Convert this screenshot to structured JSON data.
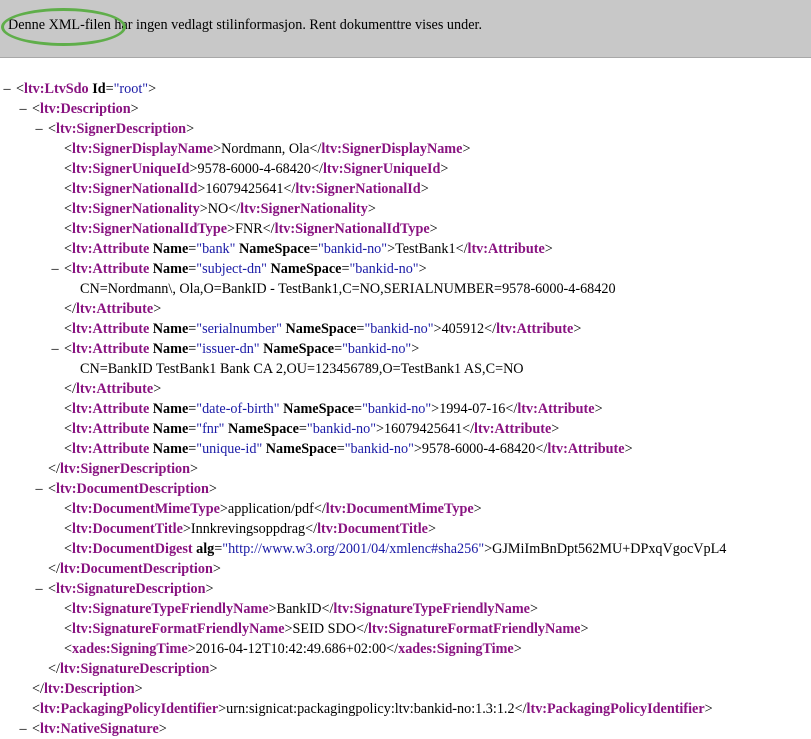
{
  "banner": {
    "message": "Denne XML-filen har ingen vedlagt stilinformasjon. Rent dokumenttre vises under."
  },
  "toggle_symbol": "–",
  "accent_colors": {
    "tag": "#881280",
    "attr_value": "#1a1aa6",
    "banner_bg": "#c8c8c8",
    "highlight_ring": "#5fae4a"
  },
  "lines": [
    {
      "toggle": true,
      "parts": [
        {
          "c": "tg",
          "v": "<"
        },
        {
          "c": "t",
          "v": "ltv:LtvSdo"
        },
        {
          "c": "tx",
          "v": " "
        },
        {
          "c": "an",
          "v": "Id"
        },
        {
          "c": "tg",
          "v": "="
        },
        {
          "c": "av",
          "v": "\"root\""
        },
        {
          "c": "tg",
          "v": ">"
        }
      ]
    },
    {
      "toggle": true,
      "parts": [
        {
          "c": "tg",
          "v": "<"
        },
        {
          "c": "t",
          "v": "ltv:Description"
        },
        {
          "c": "tg",
          "v": ">"
        }
      ]
    },
    {
      "toggle": true,
      "parts": [
        {
          "c": "tg",
          "v": "<"
        },
        {
          "c": "t",
          "v": "ltv:SignerDescription"
        },
        {
          "c": "tg",
          "v": ">"
        }
      ]
    },
    {
      "toggle": false,
      "parts": [
        {
          "c": "tg",
          "v": "<"
        },
        {
          "c": "t",
          "v": "ltv:SignerDisplayName"
        },
        {
          "c": "tg",
          "v": ">"
        },
        {
          "c": "tx",
          "v": "Nordmann, Ola"
        },
        {
          "c": "tg",
          "v": "</"
        },
        {
          "c": "t",
          "v": "ltv:SignerDisplayName"
        },
        {
          "c": "tg",
          "v": ">"
        }
      ]
    },
    {
      "toggle": false,
      "parts": [
        {
          "c": "tg",
          "v": "<"
        },
        {
          "c": "t",
          "v": "ltv:SignerUniqueId"
        },
        {
          "c": "tg",
          "v": ">"
        },
        {
          "c": "tx",
          "v": "9578-6000-4-68420"
        },
        {
          "c": "tg",
          "v": "</"
        },
        {
          "c": "t",
          "v": "ltv:SignerUniqueId"
        },
        {
          "c": "tg",
          "v": ">"
        }
      ]
    },
    {
      "toggle": false,
      "parts": [
        {
          "c": "tg",
          "v": "<"
        },
        {
          "c": "t",
          "v": "ltv:SignerNationalId"
        },
        {
          "c": "tg",
          "v": ">"
        },
        {
          "c": "tx",
          "v": "16079425641"
        },
        {
          "c": "tg",
          "v": "</"
        },
        {
          "c": "t",
          "v": "ltv:SignerNationalId"
        },
        {
          "c": "tg",
          "v": ">"
        }
      ]
    },
    {
      "toggle": false,
      "parts": [
        {
          "c": "tg",
          "v": "<"
        },
        {
          "c": "t",
          "v": "ltv:SignerNationality"
        },
        {
          "c": "tg",
          "v": ">"
        },
        {
          "c": "tx",
          "v": "NO"
        },
        {
          "c": "tg",
          "v": "</"
        },
        {
          "c": "t",
          "v": "ltv:SignerNationality"
        },
        {
          "c": "tg",
          "v": ">"
        }
      ]
    },
    {
      "toggle": false,
      "parts": [
        {
          "c": "tg",
          "v": "<"
        },
        {
          "c": "t",
          "v": "ltv:SignerNationalIdType"
        },
        {
          "c": "tg",
          "v": ">"
        },
        {
          "c": "tx",
          "v": "FNR"
        },
        {
          "c": "tg",
          "v": "</"
        },
        {
          "c": "t",
          "v": "ltv:SignerNationalIdType"
        },
        {
          "c": "tg",
          "v": ">"
        }
      ]
    },
    {
      "toggle": false,
      "parts": [
        {
          "c": "tg",
          "v": "<"
        },
        {
          "c": "t",
          "v": "ltv:Attribute"
        },
        {
          "c": "tx",
          "v": " "
        },
        {
          "c": "an",
          "v": "Name"
        },
        {
          "c": "tg",
          "v": "="
        },
        {
          "c": "av",
          "v": "\"bank\""
        },
        {
          "c": "tx",
          "v": " "
        },
        {
          "c": "an",
          "v": "NameSpace"
        },
        {
          "c": "tg",
          "v": "="
        },
        {
          "c": "av",
          "v": "\"bankid-no\""
        },
        {
          "c": "tg",
          "v": ">"
        },
        {
          "c": "tx",
          "v": "TestBank1"
        },
        {
          "c": "tg",
          "v": "</"
        },
        {
          "c": "t",
          "v": "ltv:Attribute"
        },
        {
          "c": "tg",
          "v": ">"
        }
      ]
    },
    {
      "toggle": true,
      "parts": [
        {
          "c": "tg",
          "v": "<"
        },
        {
          "c": "t",
          "v": "ltv:Attribute"
        },
        {
          "c": "tx",
          "v": " "
        },
        {
          "c": "an",
          "v": "Name"
        },
        {
          "c": "tg",
          "v": "="
        },
        {
          "c": "av",
          "v": "\"subject-dn\""
        },
        {
          "c": "tx",
          "v": " "
        },
        {
          "c": "an",
          "v": "NameSpace"
        },
        {
          "c": "tg",
          "v": "="
        },
        {
          "c": "av",
          "v": "\"bankid-no\""
        },
        {
          "c": "tg",
          "v": ">"
        }
      ]
    },
    {
      "toggle": false,
      "parts": [
        {
          "c": "tx",
          "v": "CN=Nordmann\\, Ola,O=BankID - TestBank1,C=NO,SERIALNUMBER=9578-6000-4-68420"
        }
      ]
    },
    {
      "toggle": false,
      "parts": [
        {
          "c": "tg",
          "v": "</"
        },
        {
          "c": "t",
          "v": "ltv:Attribute"
        },
        {
          "c": "tg",
          "v": ">"
        }
      ]
    },
    {
      "toggle": false,
      "parts": [
        {
          "c": "tg",
          "v": "<"
        },
        {
          "c": "t",
          "v": "ltv:Attribute"
        },
        {
          "c": "tx",
          "v": " "
        },
        {
          "c": "an",
          "v": "Name"
        },
        {
          "c": "tg",
          "v": "="
        },
        {
          "c": "av",
          "v": "\"serialnumber\""
        },
        {
          "c": "tx",
          "v": " "
        },
        {
          "c": "an",
          "v": "NameSpace"
        },
        {
          "c": "tg",
          "v": "="
        },
        {
          "c": "av",
          "v": "\"bankid-no\""
        },
        {
          "c": "tg",
          "v": ">"
        },
        {
          "c": "tx",
          "v": "405912"
        },
        {
          "c": "tg",
          "v": "</"
        },
        {
          "c": "t",
          "v": "ltv:Attribute"
        },
        {
          "c": "tg",
          "v": ">"
        }
      ]
    },
    {
      "toggle": true,
      "parts": [
        {
          "c": "tg",
          "v": "<"
        },
        {
          "c": "t",
          "v": "ltv:Attribute"
        },
        {
          "c": "tx",
          "v": " "
        },
        {
          "c": "an",
          "v": "Name"
        },
        {
          "c": "tg",
          "v": "="
        },
        {
          "c": "av",
          "v": "\"issuer-dn\""
        },
        {
          "c": "tx",
          "v": " "
        },
        {
          "c": "an",
          "v": "NameSpace"
        },
        {
          "c": "tg",
          "v": "="
        },
        {
          "c": "av",
          "v": "\"bankid-no\""
        },
        {
          "c": "tg",
          "v": ">"
        }
      ]
    },
    {
      "toggle": false,
      "parts": [
        {
          "c": "tx",
          "v": "CN=BankID TestBank1 Bank CA 2,OU=123456789,O=TestBank1 AS,C=NO"
        }
      ]
    },
    {
      "toggle": false,
      "parts": [
        {
          "c": "tg",
          "v": "</"
        },
        {
          "c": "t",
          "v": "ltv:Attribute"
        },
        {
          "c": "tg",
          "v": ">"
        }
      ]
    },
    {
      "toggle": false,
      "parts": [
        {
          "c": "tg",
          "v": "<"
        },
        {
          "c": "t",
          "v": "ltv:Attribute"
        },
        {
          "c": "tx",
          "v": " "
        },
        {
          "c": "an",
          "v": "Name"
        },
        {
          "c": "tg",
          "v": "="
        },
        {
          "c": "av",
          "v": "\"date-of-birth\""
        },
        {
          "c": "tx",
          "v": " "
        },
        {
          "c": "an",
          "v": "NameSpace"
        },
        {
          "c": "tg",
          "v": "="
        },
        {
          "c": "av",
          "v": "\"bankid-no\""
        },
        {
          "c": "tg",
          "v": ">"
        },
        {
          "c": "tx",
          "v": "1994-07-16"
        },
        {
          "c": "tg",
          "v": "</"
        },
        {
          "c": "t",
          "v": "ltv:Attribute"
        },
        {
          "c": "tg",
          "v": ">"
        }
      ]
    },
    {
      "toggle": false,
      "parts": [
        {
          "c": "tg",
          "v": "<"
        },
        {
          "c": "t",
          "v": "ltv:Attribute"
        },
        {
          "c": "tx",
          "v": " "
        },
        {
          "c": "an",
          "v": "Name"
        },
        {
          "c": "tg",
          "v": "="
        },
        {
          "c": "av",
          "v": "\"fnr\""
        },
        {
          "c": "tx",
          "v": " "
        },
        {
          "c": "an",
          "v": "NameSpace"
        },
        {
          "c": "tg",
          "v": "="
        },
        {
          "c": "av",
          "v": "\"bankid-no\""
        },
        {
          "c": "tg",
          "v": ">"
        },
        {
          "c": "tx",
          "v": "16079425641"
        },
        {
          "c": "tg",
          "v": "</"
        },
        {
          "c": "t",
          "v": "ltv:Attribute"
        },
        {
          "c": "tg",
          "v": ">"
        }
      ]
    },
    {
      "toggle": false,
      "parts": [
        {
          "c": "tg",
          "v": "<"
        },
        {
          "c": "t",
          "v": "ltv:Attribute"
        },
        {
          "c": "tx",
          "v": " "
        },
        {
          "c": "an",
          "v": "Name"
        },
        {
          "c": "tg",
          "v": "="
        },
        {
          "c": "av",
          "v": "\"unique-id\""
        },
        {
          "c": "tx",
          "v": " "
        },
        {
          "c": "an",
          "v": "NameSpace"
        },
        {
          "c": "tg",
          "v": "="
        },
        {
          "c": "av",
          "v": "\"bankid-no\""
        },
        {
          "c": "tg",
          "v": ">"
        },
        {
          "c": "tx",
          "v": "9578-6000-4-68420"
        },
        {
          "c": "tg",
          "v": "</"
        },
        {
          "c": "t",
          "v": "ltv:Attribute"
        },
        {
          "c": "tg",
          "v": ">"
        }
      ]
    },
    {
      "toggle": false,
      "parts": [
        {
          "c": "tg",
          "v": "</"
        },
        {
          "c": "t",
          "v": "ltv:SignerDescription"
        },
        {
          "c": "tg",
          "v": ">"
        }
      ]
    },
    {
      "toggle": true,
      "parts": [
        {
          "c": "tg",
          "v": "<"
        },
        {
          "c": "t",
          "v": "ltv:DocumentDescription"
        },
        {
          "c": "tg",
          "v": ">"
        }
      ]
    },
    {
      "toggle": false,
      "parts": [
        {
          "c": "tg",
          "v": "<"
        },
        {
          "c": "t",
          "v": "ltv:DocumentMimeType"
        },
        {
          "c": "tg",
          "v": ">"
        },
        {
          "c": "tx",
          "v": "application/pdf"
        },
        {
          "c": "tg",
          "v": "</"
        },
        {
          "c": "t",
          "v": "ltv:DocumentMimeType"
        },
        {
          "c": "tg",
          "v": ">"
        }
      ]
    },
    {
      "toggle": false,
      "parts": [
        {
          "c": "tg",
          "v": "<"
        },
        {
          "c": "t",
          "v": "ltv:DocumentTitle"
        },
        {
          "c": "tg",
          "v": ">"
        },
        {
          "c": "tx",
          "v": "Innkrevingsoppdrag"
        },
        {
          "c": "tg",
          "v": "</"
        },
        {
          "c": "t",
          "v": "ltv:DocumentTitle"
        },
        {
          "c": "tg",
          "v": ">"
        }
      ]
    },
    {
      "toggle": false,
      "parts": [
        {
          "c": "tg",
          "v": "<"
        },
        {
          "c": "t",
          "v": "ltv:DocumentDigest"
        },
        {
          "c": "tx",
          "v": " "
        },
        {
          "c": "an",
          "v": "alg"
        },
        {
          "c": "tg",
          "v": "="
        },
        {
          "c": "av",
          "v": "\"http://www.w3.org/2001/04/xmlenc#sha256\""
        },
        {
          "c": "tg",
          "v": ">"
        },
        {
          "c": "tx",
          "v": "GJMiImBnDpt562MU+DPxqVgocVpL4"
        }
      ]
    },
    {
      "toggle": false,
      "parts": [
        {
          "c": "tg",
          "v": "</"
        },
        {
          "c": "t",
          "v": "ltv:DocumentDescription"
        },
        {
          "c": "tg",
          "v": ">"
        }
      ]
    },
    {
      "toggle": true,
      "parts": [
        {
          "c": "tg",
          "v": "<"
        },
        {
          "c": "t",
          "v": "ltv:SignatureDescription"
        },
        {
          "c": "tg",
          "v": ">"
        }
      ]
    },
    {
      "toggle": false,
      "parts": [
        {
          "c": "tg",
          "v": "<"
        },
        {
          "c": "t",
          "v": "ltv:SignatureTypeFriendlyName"
        },
        {
          "c": "tg",
          "v": ">"
        },
        {
          "c": "tx",
          "v": "BankID"
        },
        {
          "c": "tg",
          "v": "</"
        },
        {
          "c": "t",
          "v": "ltv:SignatureTypeFriendlyName"
        },
        {
          "c": "tg",
          "v": ">"
        }
      ]
    },
    {
      "toggle": false,
      "parts": [
        {
          "c": "tg",
          "v": "<"
        },
        {
          "c": "t",
          "v": "ltv:SignatureFormatFriendlyName"
        },
        {
          "c": "tg",
          "v": ">"
        },
        {
          "c": "tx",
          "v": "SEID SDO"
        },
        {
          "c": "tg",
          "v": "</"
        },
        {
          "c": "t",
          "v": "ltv:SignatureFormatFriendlyName"
        },
        {
          "c": "tg",
          "v": ">"
        }
      ]
    },
    {
      "toggle": false,
      "parts": [
        {
          "c": "tg",
          "v": "<"
        },
        {
          "c": "t",
          "v": "xades:SigningTime"
        },
        {
          "c": "tg",
          "v": ">"
        },
        {
          "c": "tx",
          "v": "2016-04-12T10:42:49.686+02:00"
        },
        {
          "c": "tg",
          "v": "</"
        },
        {
          "c": "t",
          "v": "xades:SigningTime"
        },
        {
          "c": "tg",
          "v": ">"
        }
      ]
    },
    {
      "toggle": false,
      "parts": [
        {
          "c": "tg",
          "v": "</"
        },
        {
          "c": "t",
          "v": "ltv:SignatureDescription"
        },
        {
          "c": "tg",
          "v": ">"
        }
      ]
    },
    {
      "toggle": false,
      "parts": [
        {
          "c": "tg",
          "v": "</"
        },
        {
          "c": "t",
          "v": "ltv:Description"
        },
        {
          "c": "tg",
          "v": ">"
        }
      ]
    },
    {
      "toggle": false,
      "parts": [
        {
          "c": "tg",
          "v": "<"
        },
        {
          "c": "t",
          "v": "ltv:PackagingPolicyIdentifier"
        },
        {
          "c": "tg",
          "v": ">"
        },
        {
          "c": "tx",
          "v": "urn:signicat:packagingpolicy:ltv:bankid-no:1.3:1.2"
        },
        {
          "c": "tg",
          "v": "</"
        },
        {
          "c": "t",
          "v": "ltv:PackagingPolicyIdentifier"
        },
        {
          "c": "tg",
          "v": ">"
        }
      ]
    },
    {
      "toggle": true,
      "parts": [
        {
          "c": "tg",
          "v": "<"
        },
        {
          "c": "t",
          "v": "ltv:NativeSignature"
        },
        {
          "c": "tg",
          "v": ">"
        }
      ]
    }
  ]
}
